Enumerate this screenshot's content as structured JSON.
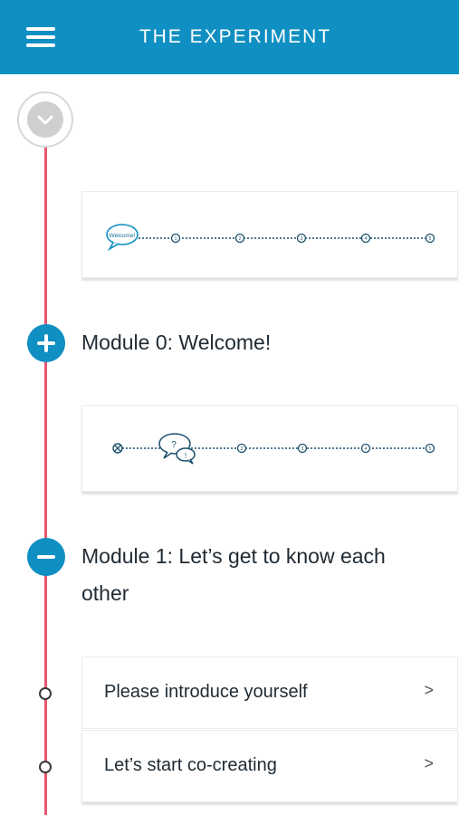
{
  "header": {
    "title": "THE EXPERIMENT",
    "menu_icon": "hamburger-menu-icon"
  },
  "timeline": {
    "line_color": "#e8566f",
    "accent_color": "#0f8fc2",
    "collapse_icon": "chevron-down-icon"
  },
  "progress_cards": [
    {
      "bubble_text": "Welcome!",
      "milestone_numbers": [
        "1",
        "2",
        "3",
        "4",
        "5"
      ]
    },
    {
      "bubble_text": "?",
      "bubble_text_2": "!",
      "milestone_numbers": [
        "2",
        "3",
        "4",
        "5"
      ]
    }
  ],
  "modules": [
    {
      "title": "Module 0: Welcome!",
      "state": "collapsed",
      "toggle_icon": "plus-icon"
    },
    {
      "title_line1": "Module 1: Let’s get to know each",
      "title_line2": "other",
      "state": "expanded",
      "toggle_icon": "minus-icon"
    }
  ],
  "lessons": [
    {
      "label": "Please introduce yourself",
      "chevron": ">"
    },
    {
      "label": "Let’s start co-creating",
      "chevron": ">"
    }
  ]
}
